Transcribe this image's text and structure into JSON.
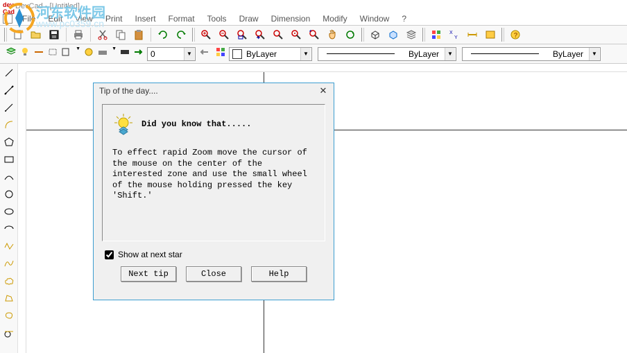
{
  "window": {
    "title": "DevCad - [Untitled]"
  },
  "watermark": {
    "text": "河东软件园",
    "url": "www.pc0359.cn"
  },
  "menu": {
    "file": "File",
    "edit": "Edit",
    "view": "View",
    "print": "Print",
    "insert": "Insert",
    "format": "Format",
    "tools": "Tools",
    "draw": "Draw",
    "dimension": "Dimension",
    "modify": "Modify",
    "window": "Window",
    "help": "?"
  },
  "layer_bar": {
    "layer_value": "0"
  },
  "props": {
    "color_label": "ByLayer",
    "linetype_label": "ByLayer",
    "lineweight_label": "ByLayer"
  },
  "dialog": {
    "title": "Tip of the day....",
    "heading": "Did you know that.....",
    "body": "To effect rapid Zoom move the cursor of the mouse on the center of the interested zone and use the small wheel of the mouse holding pressed the key 'Shift.'",
    "show_at_start": "Show at next star",
    "next_tip": "Next tip",
    "close": "Close",
    "help_btn": "Help"
  }
}
